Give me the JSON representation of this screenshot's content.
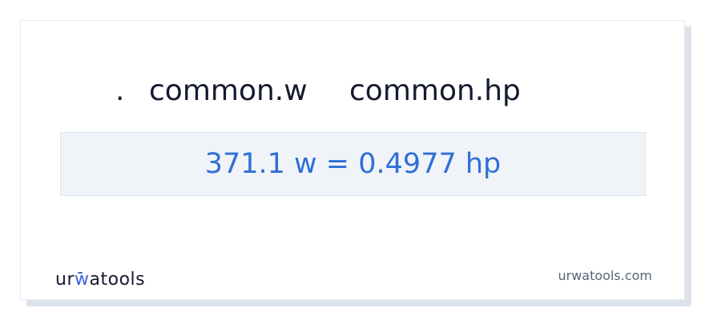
{
  "conversion": {
    "separator": ".",
    "from_unit": "common.w",
    "to_unit": "common.hp",
    "result": "371.1 w = 0.4977 hp"
  },
  "branding": {
    "logo_part1": "ur",
    "logo_part2": "w",
    "logo_part3": "atools",
    "website": "urwatools.com"
  },
  "colors": {
    "accent": "#2f6fd6",
    "logo_accent": "#3d63d8",
    "result_background": "#f0f4f8"
  }
}
